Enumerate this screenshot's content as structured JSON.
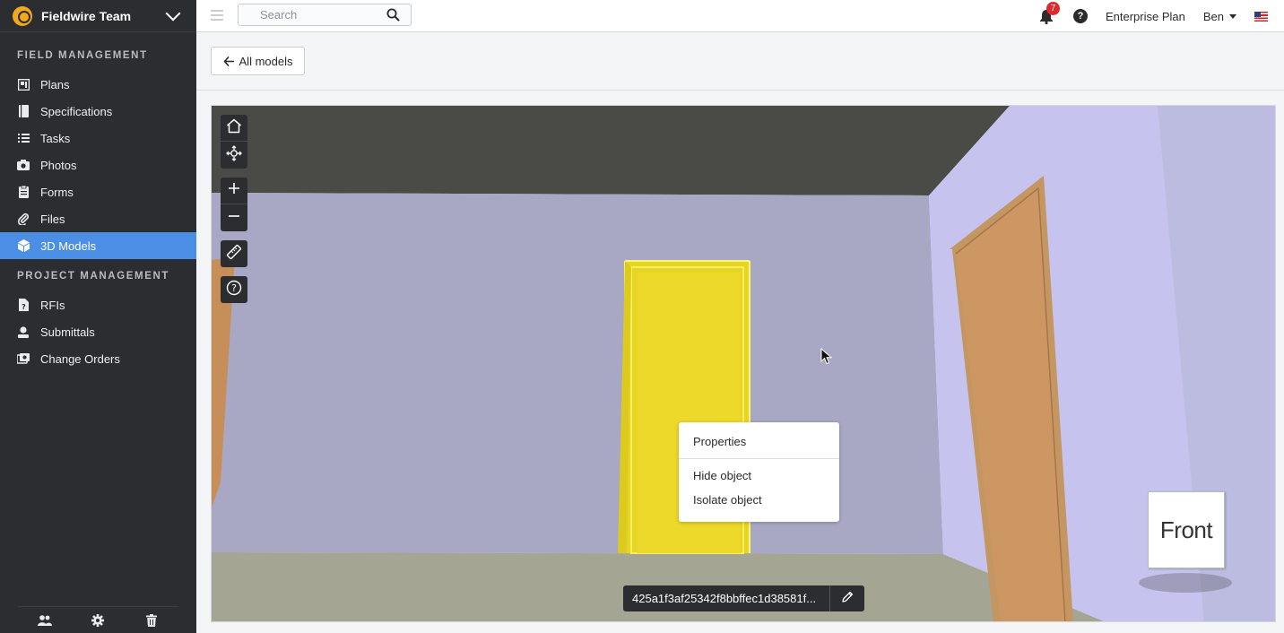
{
  "sidebar": {
    "team_name": "Fieldwire Team",
    "section_field": "FIELD MANAGEMENT",
    "field_items": [
      {
        "label": "Plans",
        "icon": "plans-icon"
      },
      {
        "label": "Specifications",
        "icon": "specifications-icon"
      },
      {
        "label": "Tasks",
        "icon": "tasks-icon"
      },
      {
        "label": "Photos",
        "icon": "camera-icon"
      },
      {
        "label": "Forms",
        "icon": "forms-icon"
      },
      {
        "label": "Files",
        "icon": "paperclip-icon"
      },
      {
        "label": "3D Models",
        "icon": "cube-icon"
      }
    ],
    "section_project": "PROJECT MANAGEMENT",
    "project_items": [
      {
        "label": "RFIs",
        "icon": "rfi-icon"
      },
      {
        "label": "Submittals",
        "icon": "submittals-icon"
      },
      {
        "label": "Change Orders",
        "icon": "change-orders-icon"
      }
    ],
    "active_item": "3D Models",
    "accent_color": "#4b8ee6"
  },
  "topbar": {
    "search_placeholder": "Search",
    "notification_count": "7",
    "plan_label": "Enterprise Plan",
    "user_name": "Ben"
  },
  "subheader": {
    "back_label": "All models"
  },
  "viewer": {
    "context_menu": {
      "properties": "Properties",
      "hide": "Hide object",
      "isolate": "Isolate object"
    },
    "view_cube_label": "Front",
    "object_id": "425a1f3af25342f8bbffec1d38581f...",
    "selection_color": "#f2e22a"
  }
}
